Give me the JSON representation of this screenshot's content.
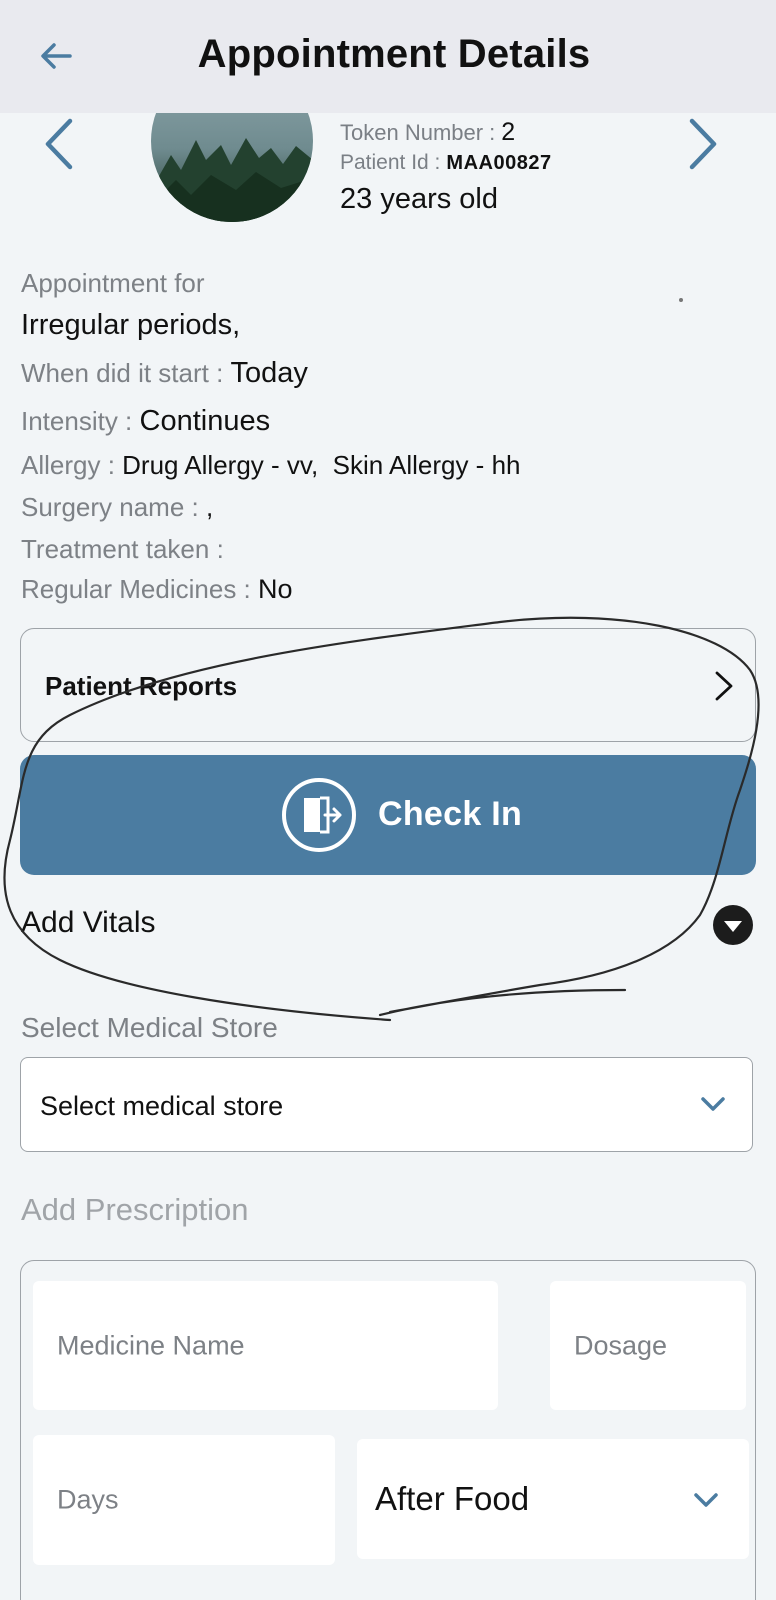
{
  "header": {
    "title": "Appointment Details"
  },
  "patient": {
    "token_label": "Token Number :",
    "token_value": "2",
    "id_label": "Patient Id :",
    "id_value": "MAA00827",
    "age": "23 years old"
  },
  "details": {
    "appointment_for_label": "Appointment for",
    "appointment_for_value": "Irregular periods,",
    "start_label": "When did it start :",
    "start_value": "Today",
    "intensity_label": "Intensity :",
    "intensity_value": "Continues",
    "allergy_label": "Allergy :",
    "allergy_value": "Drug Allergy - vv,  Skin Allergy - hh",
    "surgery_label": "Surgery name :",
    "surgery_value": ",",
    "treatment_label": "Treatment taken :",
    "medicines_label": "Regular Medicines :",
    "medicines_value": "No"
  },
  "reports": {
    "label": "Patient Reports"
  },
  "checkin": {
    "label": "Check In"
  },
  "vitals": {
    "label": "Add Vitals"
  },
  "store": {
    "section_label": "Select Medical Store",
    "selected": "Select medical store"
  },
  "prescription": {
    "section_label": "Add Prescription",
    "medicine_placeholder": "Medicine Name",
    "dosage_placeholder": "Dosage",
    "days_placeholder": "Days",
    "timing_selected": "After Food"
  },
  "colors": {
    "accent": "#4b7ca1",
    "appbar": "#e9eaef",
    "background": "#f2f5f7"
  }
}
